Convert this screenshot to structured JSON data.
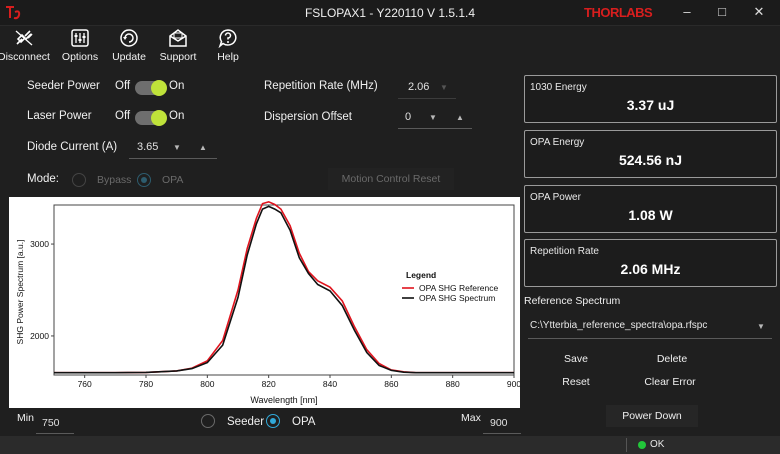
{
  "window": {
    "title": "FSLOPAX1 - Y220110 V 1.5.1.4",
    "brand": "THORLABS",
    "minimize_glyph": "–",
    "maximize_glyph": "□",
    "close_glyph": "✕"
  },
  "toolbar": {
    "items": [
      {
        "label": "Disconnect",
        "icon": "disconnect-icon"
      },
      {
        "label": "Options",
        "icon": "sliders-icon"
      },
      {
        "label": "Update",
        "icon": "refresh-icon"
      },
      {
        "label": "Support",
        "icon": "mail-icon"
      },
      {
        "label": "Help",
        "icon": "help-icon"
      }
    ]
  },
  "controls": {
    "seeder_power": {
      "label": "Seeder Power",
      "off": "Off",
      "on": "On"
    },
    "laser_power": {
      "label": "Laser Power",
      "off": "Off",
      "on": "On"
    },
    "diode_current": {
      "label": "Diode Current (A)",
      "value": "3.65"
    },
    "repetition_rate": {
      "label": "Repetition Rate (MHz)",
      "value": "2.06"
    },
    "dispersion_offset": {
      "label": "Dispersion Offset",
      "value": "0"
    },
    "mode": {
      "label": "Mode:",
      "options": [
        "Bypass",
        "OPA"
      ],
      "selected": "OPA"
    },
    "motion_control_reset": "Motion Control Reset"
  },
  "readouts": [
    {
      "title": "1030 Energy",
      "value": "3.37 uJ"
    },
    {
      "title": "OPA Energy",
      "value": "524.56 nJ"
    },
    {
      "title": "OPA Power",
      "value": "1.08 W"
    },
    {
      "title": "Repetition Rate",
      "value": "2.06 MHz"
    }
  ],
  "reference": {
    "label": "Reference Spectrum",
    "path": "C:\\Ytterbia_reference_spectra\\opa.rfspc",
    "buttons": {
      "save": "Save",
      "delete": "Delete",
      "reset": "Reset",
      "clear_error": "Clear Error"
    }
  },
  "power_down": "Power Down",
  "range": {
    "min_label": "Min",
    "min_value": "750",
    "max_label": "Max",
    "max_value": "900"
  },
  "display_mode": {
    "options": [
      "Seeder",
      "OPA"
    ],
    "selected": "OPA"
  },
  "status": {
    "text": "OK",
    "color": "#22c63a"
  },
  "colors": {
    "accent": "#31a9d9",
    "toggle_on": "#bfe23a",
    "reference_line": "#e0141e",
    "spectrum_line": "#ffffff"
  },
  "chart_data": {
    "type": "line",
    "xlabel": "Wavelength [nm]",
    "ylabel": "SHG Power Spectrum [a.u.]",
    "xlim": [
      750,
      900
    ],
    "ylim": [
      1575,
      3425
    ],
    "x_ticks": [
      760,
      780,
      800,
      820,
      840,
      860,
      880,
      900
    ],
    "y_ticks": [
      2000,
      3000
    ],
    "legend": {
      "title": "Legend",
      "position": "right"
    },
    "series": [
      {
        "name": "OPA SHG Reference",
        "color": "#e0141e",
        "x": [
          750,
          770,
          780,
          790,
          795,
          800,
          805,
          810,
          813,
          816,
          818,
          820,
          822,
          824,
          827,
          830,
          833,
          836,
          840,
          844,
          848,
          852,
          856,
          860,
          864,
          868,
          872,
          876,
          880,
          890,
          900
        ],
        "y": [
          1600,
          1600,
          1603,
          1620,
          1650,
          1730,
          1950,
          2500,
          2950,
          3280,
          3440,
          3460,
          3430,
          3380,
          3200,
          2900,
          2700,
          2600,
          2530,
          2380,
          2100,
          1850,
          1700,
          1630,
          1610,
          1600,
          1600,
          1600,
          1600,
          1600,
          1600
        ]
      },
      {
        "name": "OPA SHG Spectrum",
        "color": "#ffffff",
        "x": [
          750,
          770,
          780,
          790,
          795,
          800,
          805,
          810,
          813,
          816,
          818,
          820,
          822,
          824,
          827,
          830,
          833,
          836,
          840,
          844,
          848,
          852,
          856,
          860,
          864,
          868,
          872,
          876,
          880,
          890,
          900
        ],
        "y": [
          1600,
          1600,
          1603,
          1620,
          1645,
          1710,
          1900,
          2420,
          2880,
          3220,
          3380,
          3410,
          3380,
          3340,
          3150,
          2850,
          2680,
          2560,
          2490,
          2330,
          2060,
          1820,
          1680,
          1625,
          1605,
          1600,
          1600,
          1600,
          1600,
          1600,
          1600
        ]
      }
    ]
  }
}
